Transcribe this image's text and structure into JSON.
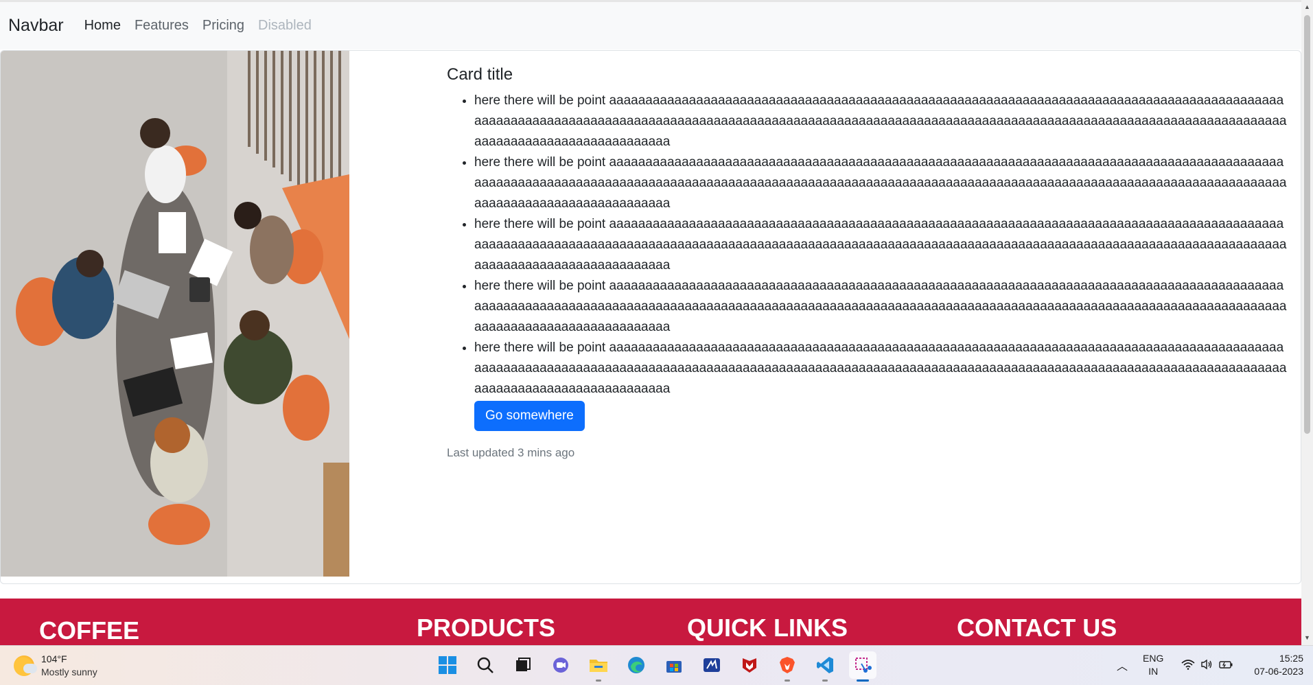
{
  "navbar": {
    "brand": "Navbar",
    "links": [
      {
        "label": "Home",
        "state": "active"
      },
      {
        "label": "Features",
        "state": "normal"
      },
      {
        "label": "Pricing",
        "state": "normal"
      },
      {
        "label": "Disabled",
        "state": "disabled"
      }
    ]
  },
  "card": {
    "title": "Card title",
    "points": [
      "here there will be point aaaaaaaaaaaaaaaaaaaaaaaaaaaaaaaaaaaaaaaaaaaaaaaaaaaaaaaaaaaaaaaaaaaaaaaaaaaaaaaaaaaaaaaaaaaaaaaaaaaaaaaaaaaaaaaaaaaaaaaaaaaaaaaaaaaaaaaaaaaaaaaaaaaaaaaaaaaaaaaaaaaaaaaaaaaaaaaaaaaaaaaaaaaaaaaaaaaaaaaaaaaaaaaaaaaaaaaaaaaaaaaaaaaaaaaa",
      "here there will be point aaaaaaaaaaaaaaaaaaaaaaaaaaaaaaaaaaaaaaaaaaaaaaaaaaaaaaaaaaaaaaaaaaaaaaaaaaaaaaaaaaaaaaaaaaaaaaaaaaaaaaaaaaaaaaaaaaaaaaaaaaaaaaaaaaaaaaaaaaaaaaaaaaaaaaaaaaaaaaaaaaaaaaaaaaaaaaaaaaaaaaaaaaaaaaaaaaaaaaaaaaaaaaaaaaaaaaaaaaaaaaaaaaaaaaaa",
      "here there will be point aaaaaaaaaaaaaaaaaaaaaaaaaaaaaaaaaaaaaaaaaaaaaaaaaaaaaaaaaaaaaaaaaaaaaaaaaaaaaaaaaaaaaaaaaaaaaaaaaaaaaaaaaaaaaaaaaaaaaaaaaaaaaaaaaaaaaaaaaaaaaaaaaaaaaaaaaaaaaaaaaaaaaaaaaaaaaaaaaaaaaaaaaaaaaaaaaaaaaaaaaaaaaaaaaaaaaaaaaaaaaaaaaaaaaaaa",
      "here there will be point aaaaaaaaaaaaaaaaaaaaaaaaaaaaaaaaaaaaaaaaaaaaaaaaaaaaaaaaaaaaaaaaaaaaaaaaaaaaaaaaaaaaaaaaaaaaaaaaaaaaaaaaaaaaaaaaaaaaaaaaaaaaaaaaaaaaaaaaaaaaaaaaaaaaaaaaaaaaaaaaaaaaaaaaaaaaaaaaaaaaaaaaaaaaaaaaaaaaaaaaaaaaaaaaaaaaaaaaaaaaaaaaaaaaaaaa",
      "here there will be point aaaaaaaaaaaaaaaaaaaaaaaaaaaaaaaaaaaaaaaaaaaaaaaaaaaaaaaaaaaaaaaaaaaaaaaaaaaaaaaaaaaaaaaaaaaaaaaaaaaaaaaaaaaaaaaaaaaaaaaaaaaaaaaaaaaaaaaaaaaaaaaaaaaaaaaaaaaaaaaaaaaaaaaaaaaaaaaaaaaaaaaaaaaaaaaaaaaaaaaaaaaaaaaaaaaaaaaaaaaaaaaaaaaaaaaa"
    ],
    "button_label": "Go somewhere",
    "updated_text": "Last updated 3 mins ago"
  },
  "footer": {
    "headings": [
      "COFFEE",
      "PRODUCTS",
      "QUICK LINKS",
      "CONTACT US"
    ],
    "bg_color": "#c8193f"
  },
  "taskbar": {
    "weather": {
      "temp": "104°F",
      "condition": "Mostly sunny"
    },
    "apps": [
      "start-icon",
      "search-icon",
      "task-view-icon",
      "chat-icon",
      "file-explorer-icon",
      "edge-icon",
      "store-icon",
      "editor-app-icon",
      "mcafee-icon",
      "brave-icon",
      "vscode-icon",
      "snipping-tool-icon"
    ],
    "lang_top": "ENG",
    "lang_bottom": "IN",
    "time": "15:25",
    "date": "07-06-2023"
  },
  "colors": {
    "primary": "#0d6efd",
    "footer": "#c8193f",
    "navbar_bg": "#f8f9fa"
  }
}
